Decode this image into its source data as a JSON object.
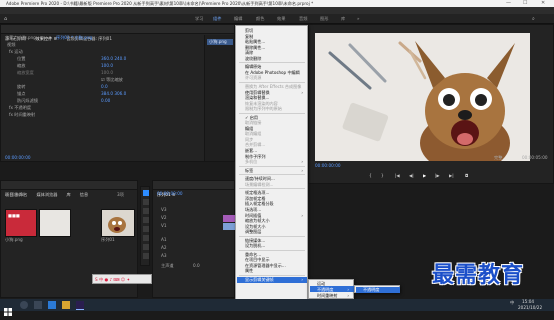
{
  "window": {
    "title": "Adobe Premiere Pro 2020 - D:\\书籍\\最新版 Premiere Pro 2020 从新手到高手\\素材\\第10章\\(未命名)\\Premiere Pro 2020\\从新手到高手\\第10章\\未命名.prproj *",
    "min": "—",
    "max": "☐",
    "close": "✕"
  },
  "menubar": [
    "文件(F)",
    "编辑(E)",
    "剪辑(C)",
    "序列(S)",
    "标记(M)",
    "图形(G)",
    "视图(V)",
    "窗口(W)",
    "帮助(H)"
  ],
  "workspaces": [
    "学习",
    "组件",
    "编辑",
    "颜色",
    "效果",
    "音频",
    "图形",
    "库",
    "»"
  ],
  "effect_controls": {
    "tabs": [
      "源:(无剪辑)",
      "效果控件 ≡",
      "音频剪辑混合器: 序列01",
      "元数据"
    ],
    "clip": "主要 * 小狗.png",
    "seq": "序列01 * 小狗.png",
    "rows": [
      {
        "label": "视频",
        "value": ""
      },
      {
        "label": "fx  运动",
        "value": ""
      },
      {
        "label": "位置",
        "value": "360.0   240.0"
      },
      {
        "label": "缩放",
        "value": "100.0"
      },
      {
        "label": "缩放宽度",
        "value": "100.0"
      },
      {
        "label": "",
        "value": "☑ 等比缩放"
      },
      {
        "label": "旋转",
        "value": "0.0"
      },
      {
        "label": "锚点",
        "value": "384.0   306.0"
      },
      {
        "label": "防闪烁滤镜",
        "value": "0.00"
      },
      {
        "label": "fx  不透明度",
        "value": ""
      },
      {
        "label": "fx  时间重映射",
        "value": ""
      }
    ],
    "timecode": "00:00:00:00",
    "mini_clip": "小狗.png"
  },
  "context_menu": {
    "items": [
      {
        "label": "剪切",
        "dis": false
      },
      {
        "label": "复制",
        "dis": false
      },
      {
        "label": "粘贴属性...",
        "dis": false
      },
      {
        "label": "删除属性...",
        "dis": false
      },
      {
        "label": "清除",
        "dis": false
      },
      {
        "label": "波纹删除",
        "dis": false
      },
      {
        "sep": true
      },
      {
        "label": "编辑原始",
        "dis": false
      },
      {
        "label": "在 Adobe Photoshop 中编辑",
        "dis": false
      },
      {
        "label": "许可资源",
        "dis": true
      },
      {
        "sep": true
      },
      {
        "label": "替换为 After Effects 合成图像",
        "dis": true
      },
      {
        "label": "使用剪辑替换",
        "dis": false,
        "sub": true
      },
      {
        "label": "渲染和替换...",
        "dis": false
      },
      {
        "label": "恢复未渲染的内容",
        "dis": true
      },
      {
        "label": "限制为序列中的原始",
        "dis": true
      },
      {
        "sep": true
      },
      {
        "label": "✓ 启用",
        "dis": false
      },
      {
        "label": "取消链接",
        "dis": true
      },
      {
        "label": "编组",
        "dis": false
      },
      {
        "label": "取消编组",
        "dis": true
      },
      {
        "label": "同步",
        "dis": true
      },
      {
        "label": "合并剪辑...",
        "dis": true
      },
      {
        "label": "嵌套...",
        "dis": false
      },
      {
        "label": "制作子序列",
        "dis": false
      },
      {
        "label": "多机位",
        "dis": true,
        "sub": true
      },
      {
        "sep": true
      },
      {
        "label": "标签",
        "dis": false,
        "sub": true
      },
      {
        "sep": true
      },
      {
        "label": "速度/持续时间...",
        "dis": false
      },
      {
        "label": "场景编辑检测...",
        "dis": true
      },
      {
        "sep": true
      },
      {
        "label": "帧定格选项...",
        "dis": false
      },
      {
        "label": "添加帧定格",
        "dis": false
      },
      {
        "label": "插入帧定格分段",
        "dis": false
      },
      {
        "label": "场选项...",
        "dis": false
      },
      {
        "label": "时间插值",
        "dis": false,
        "sub": true
      },
      {
        "label": "缩放为帧大小",
        "dis": false
      },
      {
        "label": "设为帧大小",
        "dis": false
      },
      {
        "label": "调整图层",
        "dis": false
      },
      {
        "sep": true
      },
      {
        "label": "链接媒体...",
        "dis": false
      },
      {
        "label": "设为脱机...",
        "dis": false
      },
      {
        "sep": true
      },
      {
        "label": "重命名...",
        "dis": false
      },
      {
        "label": "在项目中显示",
        "dis": false
      },
      {
        "label": "在资源管理器中显示...",
        "dis": false
      },
      {
        "label": "属性",
        "dis": false
      },
      {
        "sep": true
      },
      {
        "label": "显示剪辑关键帧",
        "dis": false,
        "sub": true
      }
    ]
  },
  "submenu1": {
    "items": [
      "运动",
      "不透明度",
      "时间重映射"
    ]
  },
  "submenu2": {
    "items": [
      "不透明度"
    ]
  },
  "program_monitor": {
    "timecode": "00:00:00:00",
    "fit": "完整",
    "duration": "00:00:05:00"
  },
  "project": {
    "tabs": [
      "项目:未命名",
      "媒体浏览器",
      "库",
      "信息",
      "效果",
      "标记",
      "历史记录"
    ],
    "search": "◎ 项目(S)",
    "items": [
      "小狗.png",
      "序列01",
      "背景.jpg"
    ],
    "count": "3项"
  },
  "timeline": {
    "tab": "序列01 ≡",
    "timecode": "00:00:00:00",
    "tracks": [
      "V3",
      "V2",
      "V1",
      "A1",
      "A2",
      "A3",
      "主声道"
    ],
    "master": "0.0"
  },
  "watermark": "最需教育",
  "taskbar": {
    "time": "15:04",
    "date": "2021/10/22",
    "lang": "中"
  },
  "colors": {
    "accent": "#2d8cff",
    "menu_bg": "#f0f0f0",
    "highlight": "#2f6fd6",
    "watermark": "#1b4fc9"
  }
}
